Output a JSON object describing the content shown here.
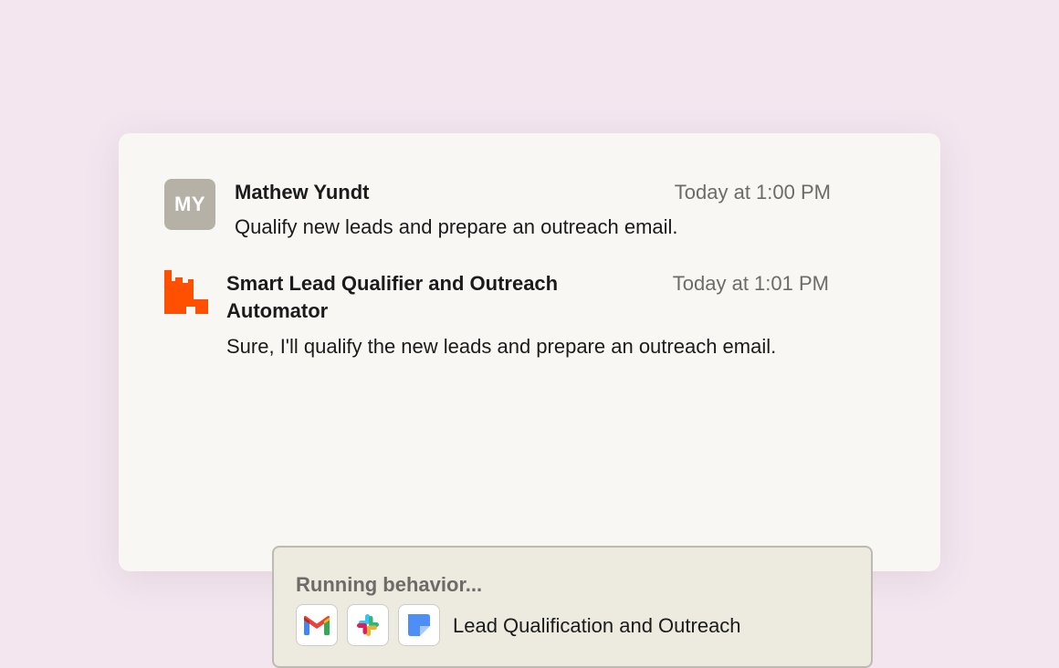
{
  "messages": {
    "user": {
      "initials": "MY",
      "name": "Mathew Yundt",
      "time": "Today at 1:00 PM",
      "text": "Qualify new leads and prepare an outreach email."
    },
    "bot": {
      "avatar_icon": "zapier-agent-icon",
      "name": "Smart Lead Qualifier and Outreach Automator",
      "time": "Today at 1:01 PM",
      "text": "Sure, I'll qualify the new leads and prepare an outreach email."
    }
  },
  "behavior": {
    "status": "Running behavior...",
    "apps": [
      "gmail-icon",
      "slack-icon",
      "docs-icon"
    ],
    "name": "Lead Qualification and Outreach"
  },
  "colors": {
    "background": "#f3e6ef",
    "card": "#f8f7f4",
    "bot_brand": "#ff4f00",
    "user_avatar": "#b5b1a6",
    "behavior_bg": "#edeadf"
  }
}
